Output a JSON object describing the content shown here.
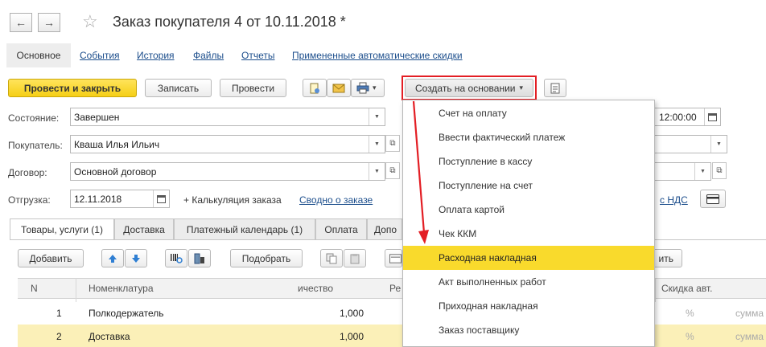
{
  "window": {
    "title": "Заказ покупателя 4 от 10.11.2018 *"
  },
  "nav": {
    "back_glyph": "←",
    "forward_glyph": "→",
    "star_glyph": "☆"
  },
  "tabs_top": {
    "active": "Основное",
    "links": [
      "События",
      "История",
      "Файлы",
      "Отчеты",
      "Примененные автоматические скидки"
    ]
  },
  "toolbar": {
    "post_close": "Провести и закрыть",
    "save": "Записать",
    "post": "Провести",
    "create_based": "Создать на основании",
    "dropdown_glyph": "▾"
  },
  "form": {
    "state_label": "Состояние:",
    "state_value": "Завершен",
    "buyer_label": "Покупатель:",
    "buyer_value": "Кваша Илья Ильич",
    "contract_label": "Договор:",
    "contract_value": "Основной договор",
    "shipment_label": "Отгрузка:",
    "shipment_value": "12.11.2018",
    "calc_link": "+ Калькуляция заказа",
    "summary_link": "Сводно о заказе",
    "time_value": "12:00:00",
    "vat_link": "с НДС"
  },
  "detail_tabs": [
    "Товары, услуги (1)",
    "Доставка",
    "Платежный календарь (1)",
    "Оплата",
    "Допо"
  ],
  "table_toolbar": {
    "add": "Добавить",
    "pick": "Подобрать",
    "partial_right": "ить"
  },
  "table": {
    "headers": {
      "n": "N",
      "nomenclature": "Номенклатура",
      "qty": "ичество",
      "partial": "Ре",
      "discount": "Скидка авт."
    },
    "rows": [
      {
        "n": "1",
        "name": "Полкодержатель",
        "qty": "1,000",
        "pct": "%",
        "sum": "сумма"
      },
      {
        "n": "2",
        "name": "Доставка",
        "qty": "1,000",
        "pct": "%",
        "sum": "сумма"
      }
    ]
  },
  "menu": {
    "items": [
      "Счет на оплату",
      "Ввести фактический платеж",
      "Поступление в кассу",
      "Поступление на счет",
      "Оплата картой",
      "Чек ККМ",
      "Расходная накладная",
      "Акт выполненных работ",
      "Приходная накладная",
      "Заказ поставщику"
    ],
    "highlighted_index": 6
  },
  "colors": {
    "accent_yellow": "#f9da2c",
    "annotation_red": "#e31e24",
    "link_blue": "#1c4e8c"
  }
}
